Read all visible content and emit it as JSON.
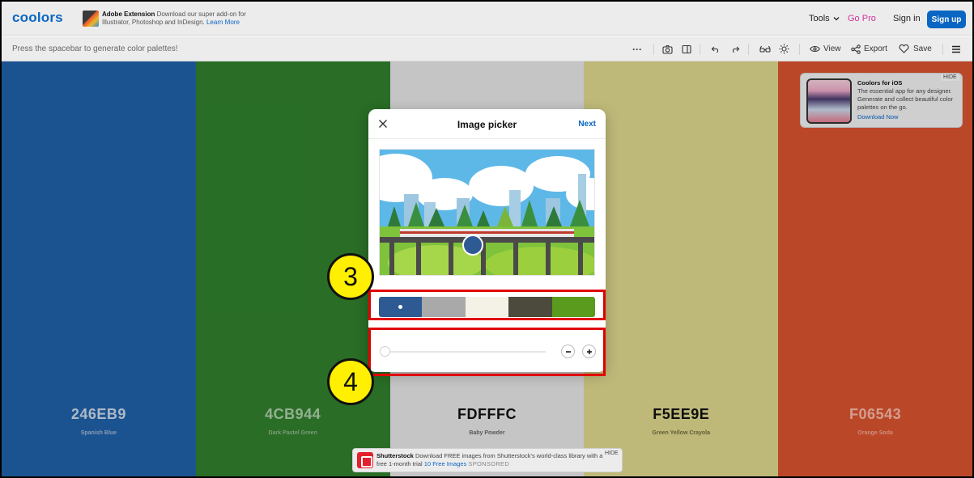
{
  "nav": {
    "logo": "coolors",
    "ext_title": "Adobe Extension",
    "ext_desc": "Download our super add-on for Illustrator, Photoshop and InDesign.",
    "ext_link": "Learn More",
    "tools": "Tools",
    "gopro": "Go Pro",
    "signin": "Sign in",
    "signup": "Sign up"
  },
  "toolbar": {
    "hint": "Press the spacebar to generate color palettes!",
    "more": "···",
    "view": "View",
    "export": "Export",
    "save": "Save"
  },
  "palette": [
    {
      "hex": "246EB9",
      "name": "Spanish Blue",
      "color": "#1f5fa6",
      "text": "#c7d3e2",
      "sub": "#9fb3cc"
    },
    {
      "hex": "4CB944",
      "name": "Dark Pastel Green",
      "color": "#2f7d2c",
      "text": "#a9c9a6",
      "sub": "#8fb28b"
    },
    {
      "hex": "FDFFFC",
      "name": "Baby Powder",
      "color": "#e1e1e1",
      "text": "#111111",
      "sub": "#666666"
    },
    {
      "hex": "F5EE9E",
      "name": "Green Yellow Crayola",
      "color": "#d9d38a",
      "text": "#111111",
      "sub": "#6e6a3e"
    },
    {
      "hex": "F06543",
      "name": "Orange Soda",
      "color": "#d5512f",
      "text": "#f0b5a3",
      "sub": "#eaa28c"
    }
  ],
  "ios": {
    "title": "Coolors for iOS",
    "desc": "The essential app for any designer. Generate and collect beautiful color palettes on the go.",
    "link": "Download Now",
    "hide": "HIDE"
  },
  "modal": {
    "title": "Image picker",
    "next": "Next",
    "swatches": [
      "#2e5a94",
      "#a9a9a9",
      "#f4f1e6",
      "#4b4a3c",
      "#5a9a1c"
    ],
    "slider_value": 0
  },
  "annotations": {
    "badge_3": "3",
    "badge_4": "4"
  },
  "sponsor": {
    "brand": "Shutterstock",
    "text": "Download",
    "text2": "FREE images from Shutterstock's world-class library with a free 1-month trial",
    "link": "10 Free Images",
    "sponsored": "SPONSORED",
    "hide": "HIDE"
  }
}
